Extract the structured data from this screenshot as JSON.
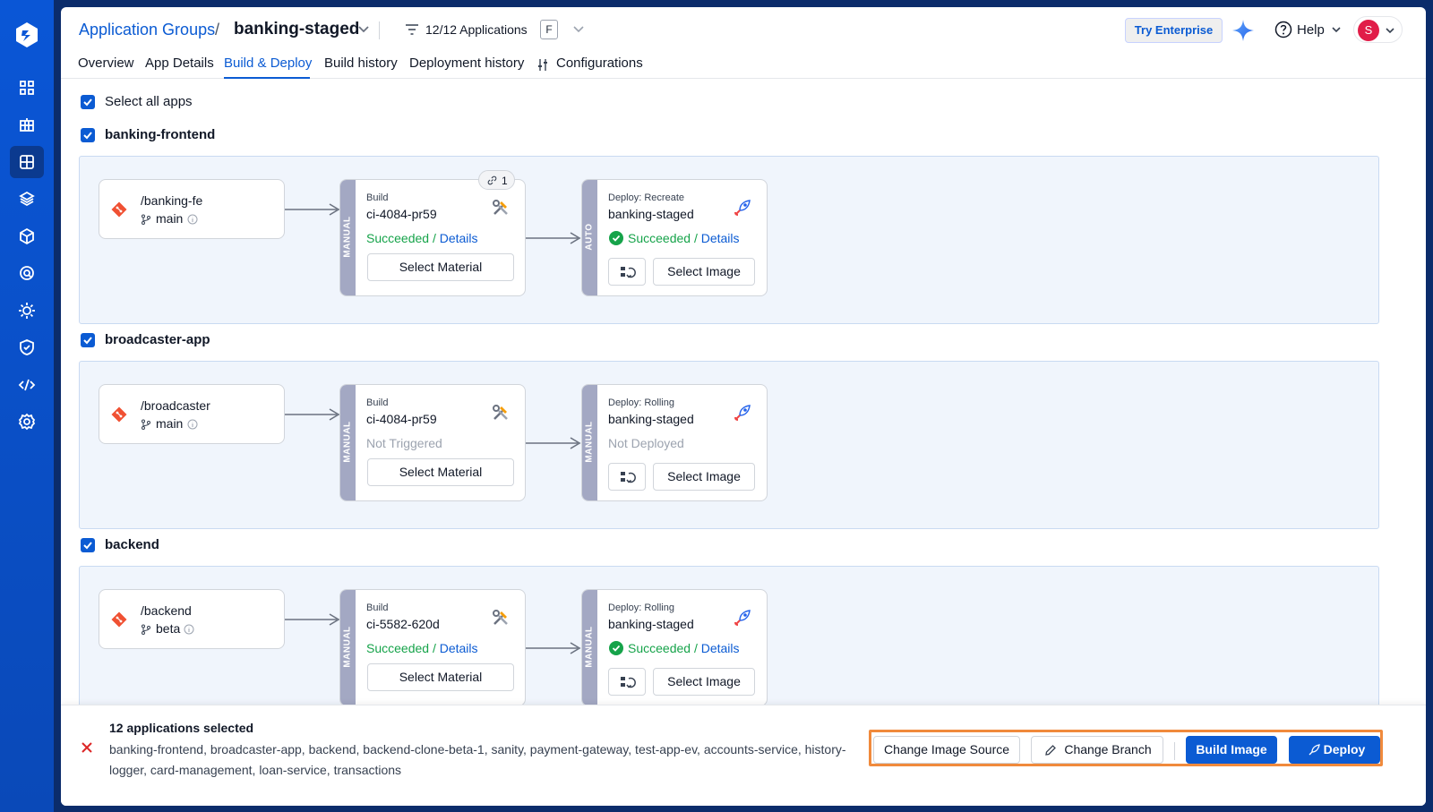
{
  "header": {
    "breadcrumb_link": "Application Groups",
    "breadcrumb_sep": "/",
    "group_name": "banking-staged",
    "filter_label": "12/12 Applications",
    "filter_badge": "F",
    "try_enterprise": "Try Enterprise",
    "help_label": "Help",
    "avatar_initial": "S"
  },
  "tabs": [
    "Overview",
    "App Details",
    "Build & Deploy",
    "Build history",
    "Deployment history",
    "Configurations"
  ],
  "active_tab": "Build & Deploy",
  "select_all_label": "Select all apps",
  "apps": [
    {
      "name": "banking-frontend",
      "source": {
        "repo": "/banking-fe",
        "branch": "main"
      },
      "build": {
        "trigger": "MANUAL",
        "type": "Build",
        "title": "ci-4084-pr59",
        "status": "Succeeded",
        "details": "Details",
        "button": "Select Material",
        "linked_count": "1"
      },
      "deploy": {
        "trigger": "AUTO",
        "type": "Deploy: Recreate",
        "title": "banking-staged",
        "status": "Succeeded",
        "details": "Details",
        "button": "Select Image"
      }
    },
    {
      "name": "broadcaster-app",
      "source": {
        "repo": "/broadcaster",
        "branch": "main"
      },
      "build": {
        "trigger": "MANUAL",
        "type": "Build",
        "title": "ci-4084-pr59",
        "status": "Not Triggered",
        "button": "Select Material"
      },
      "deploy": {
        "trigger": "MANUAL",
        "type": "Deploy: Rolling",
        "title": "banking-staged",
        "status": "Not Deployed",
        "button": "Select Image"
      }
    },
    {
      "name": "backend",
      "source": {
        "repo": "/backend",
        "branch": "beta"
      },
      "build": {
        "trigger": "MANUAL",
        "type": "Build",
        "title": "ci-5582-620d",
        "status": "Succeeded",
        "details": "Details",
        "button": "Select Material"
      },
      "deploy": {
        "trigger": "MANUAL",
        "type": "Deploy: Rolling",
        "title": "banking-staged",
        "status": "Succeeded",
        "details": "Details",
        "button": "Select Image"
      }
    }
  ],
  "footer": {
    "count_label": "12 applications selected",
    "app_list": "banking-frontend, broadcaster-app, backend, backend-clone-beta-1, sanity, payment-gateway, test-app-ev, accounts-service, history-logger, card-management, loan-service, transactions",
    "change_image_source": "Change Image Source",
    "change_branch": "Change Branch",
    "build_image": "Build Image",
    "deploy": "Deploy"
  },
  "colors": {
    "primary": "#0b5bd3",
    "success": "#16a34a",
    "highlight": "#f08a3c",
    "sidebar": "#0a56d6"
  },
  "sidebar_icons": [
    "devtron-logo-icon",
    "overview-grid-icon",
    "app-groups-icon",
    "applications-icon",
    "charts-icon",
    "resource-browser-icon",
    "resource-watcher-icon",
    "global-config-icon",
    "security-icon",
    "code-icon",
    "settings-icon"
  ]
}
